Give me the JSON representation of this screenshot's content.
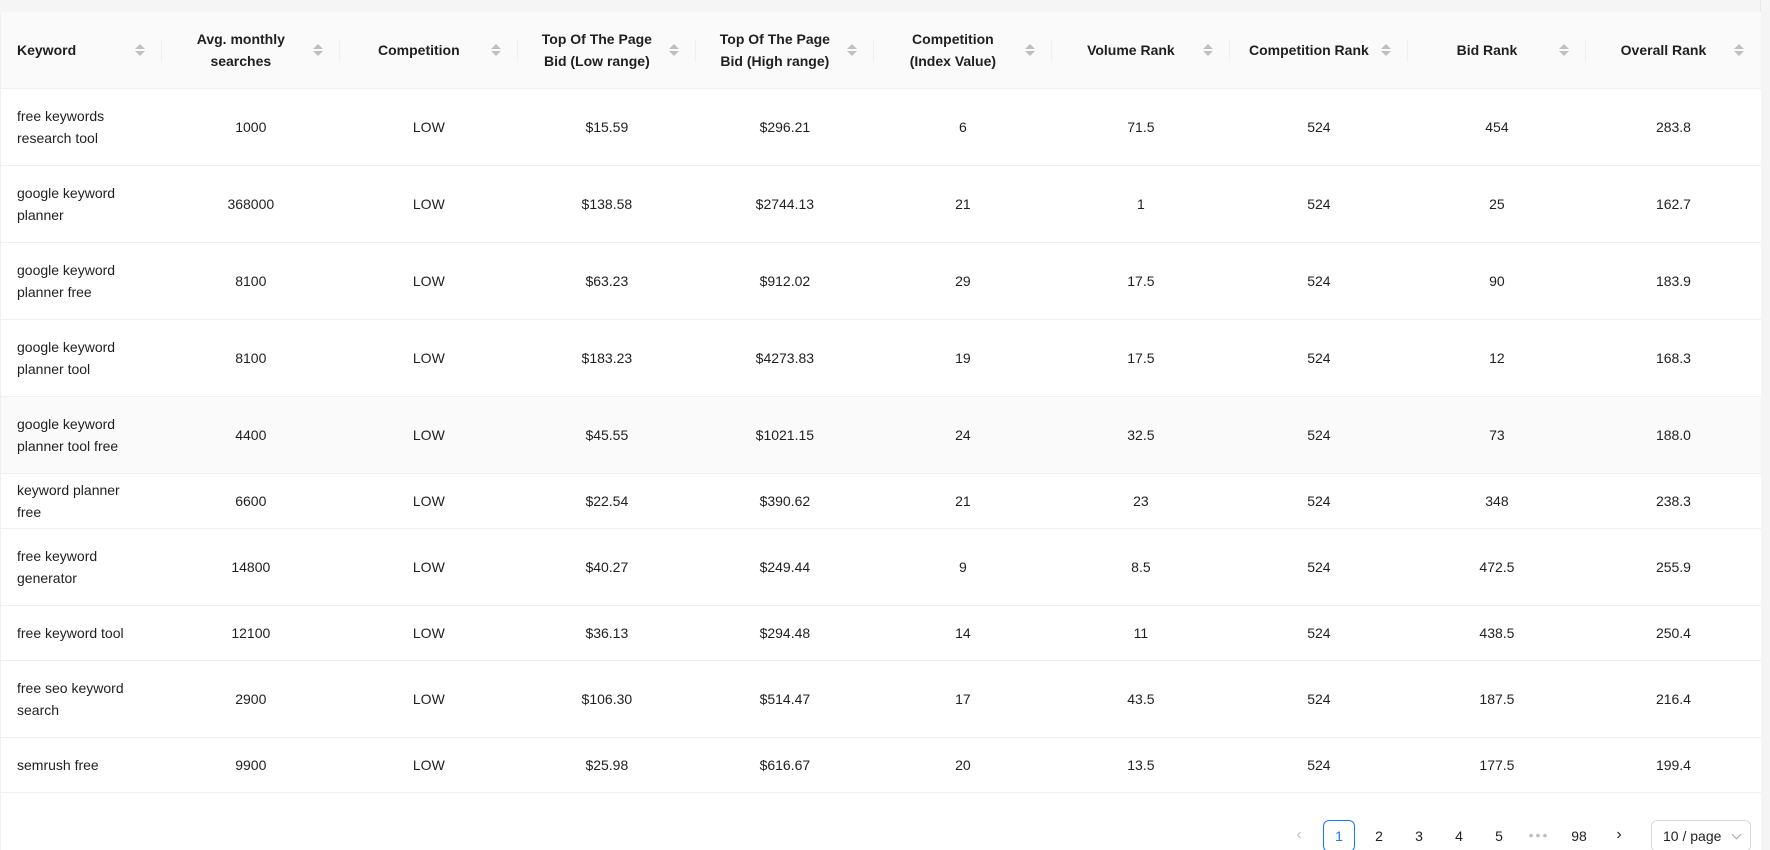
{
  "table": {
    "columns": [
      "Keyword",
      "Avg. monthly searches",
      "Competition",
      "Top Of The Page Bid (Low range)",
      "Top Of The Page Bid (High range)",
      "Competition (Index Value)",
      "Volume Rank",
      "Competition Rank",
      "Bid Rank",
      "Overall Rank"
    ],
    "rows": [
      [
        "free keywords research tool",
        "1000",
        "LOW",
        "$15.59",
        "$296.21",
        "6",
        "71.5",
        "524",
        "454",
        "283.8"
      ],
      [
        "google keyword planner",
        "368000",
        "LOW",
        "$138.58",
        "$2744.13",
        "21",
        "1",
        "524",
        "25",
        "162.7"
      ],
      [
        "google keyword planner free",
        "8100",
        "LOW",
        "$63.23",
        "$912.02",
        "29",
        "17.5",
        "524",
        "90",
        "183.9"
      ],
      [
        "google keyword planner tool",
        "8100",
        "LOW",
        "$183.23",
        "$4273.83",
        "19",
        "17.5",
        "524",
        "12",
        "168.3"
      ],
      [
        "google keyword planner tool free",
        "4400",
        "LOW",
        "$45.55",
        "$1021.15",
        "24",
        "32.5",
        "524",
        "73",
        "188.0"
      ],
      [
        "keyword planner free",
        "6600",
        "LOW",
        "$22.54",
        "$390.62",
        "21",
        "23",
        "524",
        "348",
        "238.3"
      ],
      [
        "free keyword generator",
        "14800",
        "LOW",
        "$40.27",
        "$249.44",
        "9",
        "8.5",
        "524",
        "472.5",
        "255.9"
      ],
      [
        "free keyword tool",
        "12100",
        "LOW",
        "$36.13",
        "$294.48",
        "14",
        "11",
        "524",
        "438.5",
        "250.4"
      ],
      [
        "free seo keyword search",
        "2900",
        "LOW",
        "$106.30",
        "$514.47",
        "17",
        "43.5",
        "524",
        "187.5",
        "216.4"
      ],
      [
        "semrush free",
        "9900",
        "LOW",
        "$25.98",
        "$616.67",
        "20",
        "13.5",
        "524",
        "177.5",
        "199.4"
      ]
    ],
    "hovered_row": "google keyword planner tool free"
  },
  "pagination": {
    "pages": [
      "1",
      "2",
      "3",
      "4",
      "5"
    ],
    "current_page": "1",
    "ellipsis": "•••",
    "last_page": "98",
    "page_size": "10 / page"
  },
  "colors": {
    "accent": "#1677ff",
    "header_bg": "#fafafa",
    "border": "#f0f0f0"
  }
}
